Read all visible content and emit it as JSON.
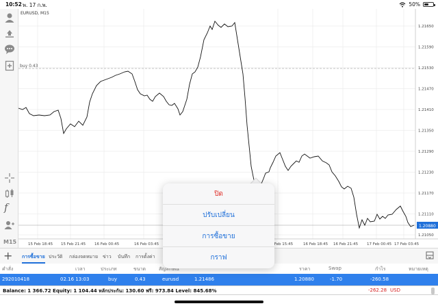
{
  "status_bar": {
    "time": "10:52",
    "date": "พ. 17 ก.พ.",
    "battery": "50%",
    "battery_level": 0.5
  },
  "toolbar": {
    "timeframe": "M15",
    "function_symbol": "f"
  },
  "chart": {
    "symbol_label": "EURUSD, M15",
    "buy_label": "buy 0.43",
    "current_price": "1.20880",
    "price_axis": [
      "1.21650",
      "1.21590",
      "1.21530",
      "1.21470",
      "1.21410",
      "1.21350",
      "1.21290",
      "1.21230",
      "1.21170",
      "1.21110",
      "1.21050",
      "1.20990",
      "1.20930"
    ],
    "time_axis": [
      "15 Feb 18:45",
      "15 Feb 21:45",
      "16 Feb 00:45",
      "16 Feb 03:45",
      "16 Feb 15:45",
      "16 Feb 18:45",
      "16 Feb 21:45",
      "17 Feb 00:45",
      "17 Feb 03:45"
    ],
    "colors": {
      "line": "#111111",
      "current_price_bg": "#1e6fd9"
    }
  },
  "popup": {
    "items": [
      "ปิด",
      "ปรับเปลี่ยน",
      "การซื้อขาย",
      "กราฟ"
    ]
  },
  "tabs": [
    "การซื้อขาย",
    "ประวัติ",
    "กล่องจดหมาย",
    "ข่าว",
    "บันทึก",
    "การตั้งค่า"
  ],
  "table": {
    "headers": [
      "คำสั่ง",
      "เวลา",
      "ประเภท",
      "ขนาด",
      "สัญลักษณ์",
      "",
      "",
      "",
      "ราคา",
      "Swap",
      "กำไร",
      "หมายเหตุ"
    ],
    "row": {
      "order": "292010418",
      "time": "02.16 13:03",
      "type": "buy",
      "size": "0.43",
      "symbol": "eurusd",
      "open_price": "1.21486",
      "price": "1.20880",
      "swap": "-1.70",
      "profit": "-260.58"
    }
  },
  "balance": {
    "text": "Balance: 1 366.72 Equity: 1 104.44 หลักประกัน: 130.60 ฟรี: 973.84 Level: 845.68%",
    "profit": "-262.28",
    "currency": "USD"
  },
  "accent_color": "#2f80ec"
}
